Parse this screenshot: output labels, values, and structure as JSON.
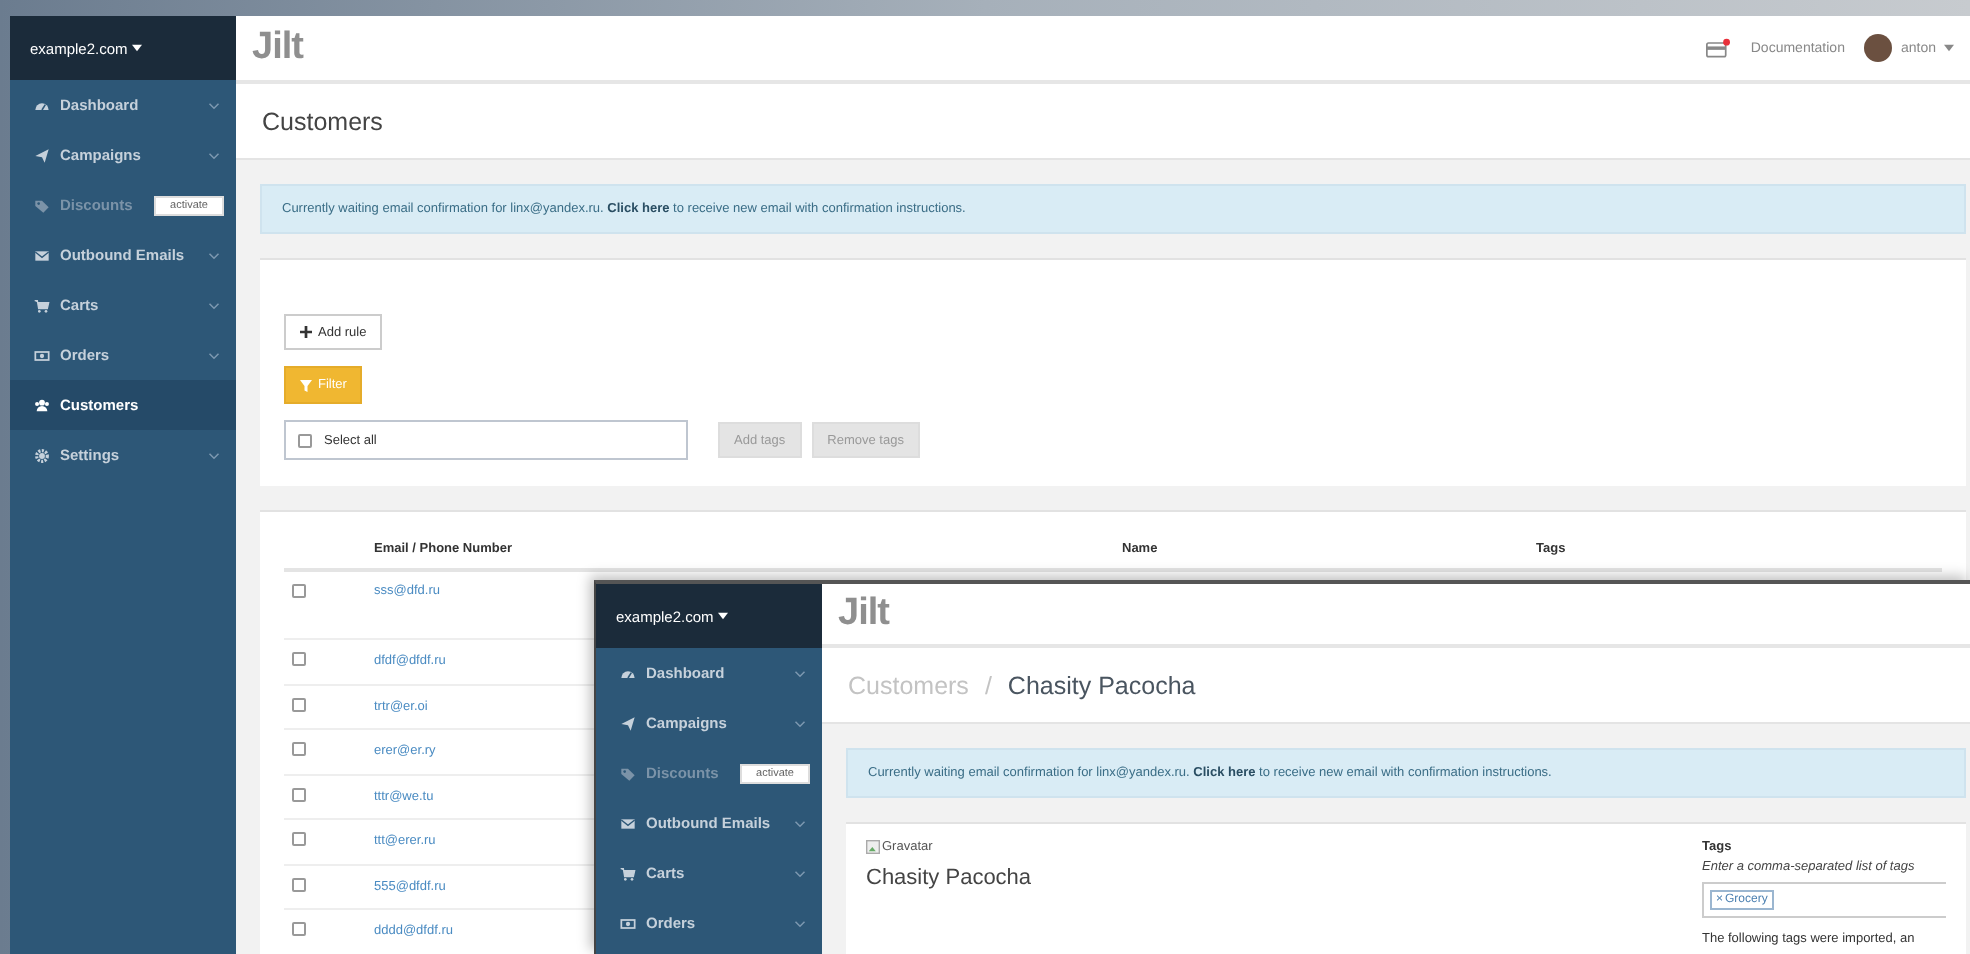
{
  "back_window": {
    "account_menu": "example2.com",
    "logo": "Jilt",
    "header": {
      "notification": true,
      "documentation": "Documentation",
      "user": "anton"
    },
    "sidebar": [
      {
        "label": "Dashboard",
        "kind": "dashboard",
        "expandable": true,
        "disabled": false,
        "selected": false
      },
      {
        "label": "Campaigns",
        "kind": "campaigns",
        "expandable": true,
        "disabled": false,
        "selected": false
      },
      {
        "label": "Discounts",
        "kind": "discounts",
        "expandable": false,
        "disabled": true,
        "selected": false,
        "badge": "activate"
      },
      {
        "label": "Outbound Emails",
        "kind": "email",
        "expandable": true,
        "disabled": false,
        "selected": false
      },
      {
        "label": "Carts",
        "kind": "cart",
        "expandable": true,
        "disabled": false,
        "selected": false
      },
      {
        "label": "Orders",
        "kind": "orders",
        "expandable": true,
        "disabled": false,
        "selected": false
      },
      {
        "label": "Customers",
        "kind": "customers",
        "expandable": false,
        "disabled": false,
        "selected": true
      },
      {
        "label": "Settings",
        "kind": "settings",
        "expandable": true,
        "disabled": false,
        "selected": false
      }
    ],
    "page_title": "Customers",
    "alert": {
      "before": "Currently waiting email confirmation for linx@yandex.ru.",
      "link": "Click here",
      "after": "to receive new email with confirmation instructions."
    },
    "filters": {
      "add_rule": "Add rule",
      "filter": "Filter",
      "select_all": {
        "label": "Select all",
        "checked": false
      },
      "add_tags": "Add tags",
      "remove_tags": "Remove tags"
    },
    "table": {
      "columns": [
        "Email / Phone Number",
        "Name",
        "Tags"
      ],
      "rows": [
        {
          "email": "sss@dfd.ru",
          "checked": false
        },
        {
          "email": "dfdf@dfdf.ru",
          "checked": false
        },
        {
          "email": "trtr@er.oi",
          "checked": false
        },
        {
          "email": "erer@er.ry",
          "checked": false
        },
        {
          "email": "tttr@we.tu",
          "checked": false
        },
        {
          "email": "ttt@erer.ru",
          "checked": false
        },
        {
          "email": "555@dfdf.ru",
          "checked": false
        },
        {
          "email": "dddd@dfdf.ru",
          "checked": false
        }
      ]
    }
  },
  "front_window": {
    "account_menu": "example2.com",
    "logo": "Jilt",
    "sidebar": [
      {
        "label": "Dashboard",
        "kind": "dashboard",
        "expandable": true,
        "disabled": false,
        "selected": false
      },
      {
        "label": "Campaigns",
        "kind": "campaigns",
        "expandable": true,
        "disabled": false,
        "selected": false
      },
      {
        "label": "Discounts",
        "kind": "discounts",
        "expandable": false,
        "disabled": true,
        "selected": false,
        "badge": "activate"
      },
      {
        "label": "Outbound Emails",
        "kind": "email",
        "expandable": true,
        "disabled": false,
        "selected": false
      },
      {
        "label": "Carts",
        "kind": "cart",
        "expandable": true,
        "disabled": false,
        "selected": false
      },
      {
        "label": "Orders",
        "kind": "orders",
        "expandable": true,
        "disabled": false,
        "selected": false
      }
    ],
    "breadcrumb": [
      "Customers",
      "Chasity Pacocha"
    ],
    "breadcrumb_separator": "/",
    "alert": {
      "before": "Currently waiting email confirmation for linx@yandex.ru.",
      "link": "Click here",
      "after": "to receive new email with confirmation instructions."
    },
    "customer": {
      "gravatar_alt": "Gravatar",
      "name": "Chasity Pacocha"
    },
    "tags": {
      "label": "Tags",
      "hint": "Enter a comma-separated list of tags",
      "values": [
        {
          "remove": "×",
          "label": "Grocery"
        }
      ],
      "note": "The following tags were imported, an"
    }
  }
}
